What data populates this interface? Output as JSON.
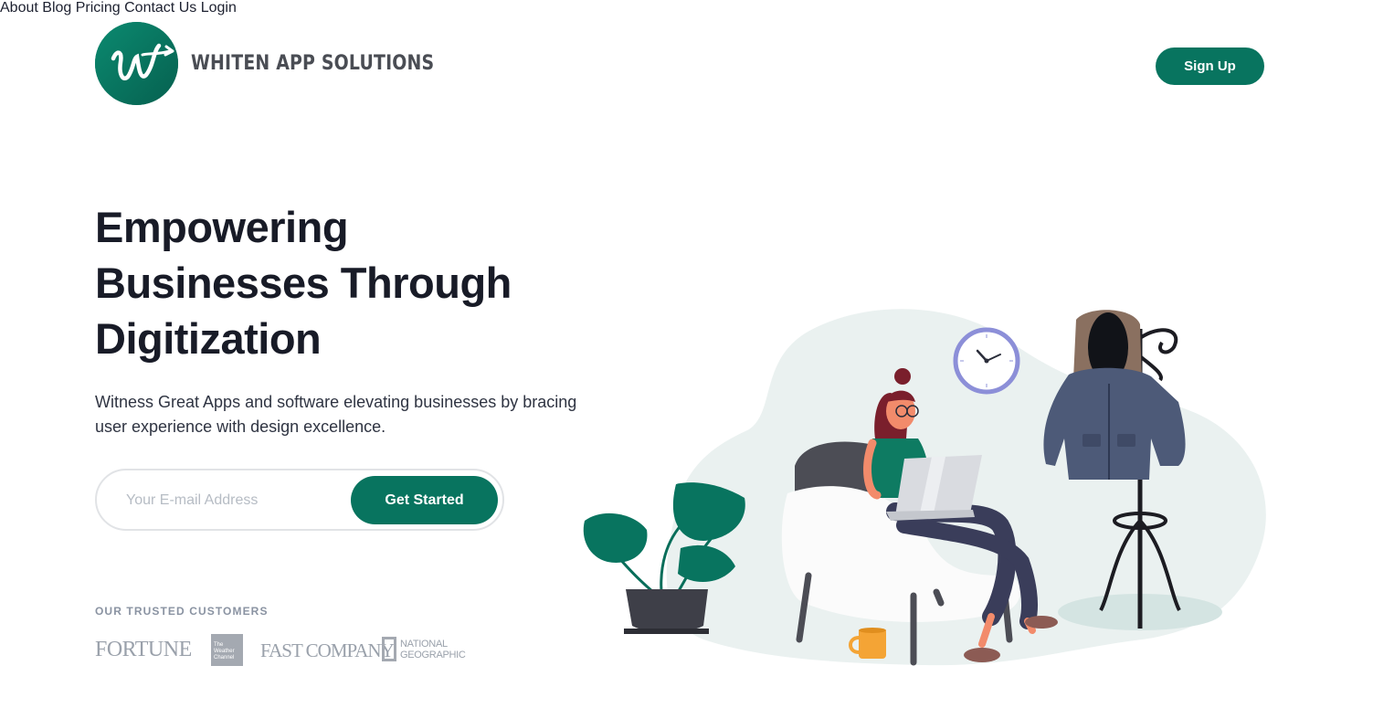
{
  "brand": {
    "name": "WHITEN APP SOLUTIONS",
    "colors": {
      "primary": "#08745f",
      "text_dark": "#181b27",
      "muted": "#8a93a2"
    }
  },
  "nav": {
    "items": [
      {
        "label": "About"
      },
      {
        "label": "Blog"
      },
      {
        "label": "Pricing"
      },
      {
        "label": "Contact Us"
      }
    ],
    "login_label": "Login",
    "signup_label": "Sign Up"
  },
  "hero": {
    "title_lines": [
      "Empowering",
      "Businesses Through",
      "Digitization"
    ],
    "description": "Witness Great Apps and software elevating businesses by bracing user experience with design excellence.",
    "email_placeholder": "Your E-mail Address",
    "cta_label": "Get Started"
  },
  "trusted": {
    "label": "OUR TRUSTED CUSTOMERS",
    "logos": {
      "fortune": "FORTUNE",
      "weather": [
        "The",
        "Weather",
        "Channel"
      ],
      "fastcompany": "FAST COMPANY",
      "natgeo": [
        "NATIONAL",
        "GEOGRAPHIC"
      ]
    }
  },
  "illustration": {
    "icons": [
      "wall-clock-icon",
      "coat-rack-icon",
      "monstera-plant-icon",
      "coffee-mug-icon",
      "armchair-icon",
      "laptop-icon"
    ]
  }
}
